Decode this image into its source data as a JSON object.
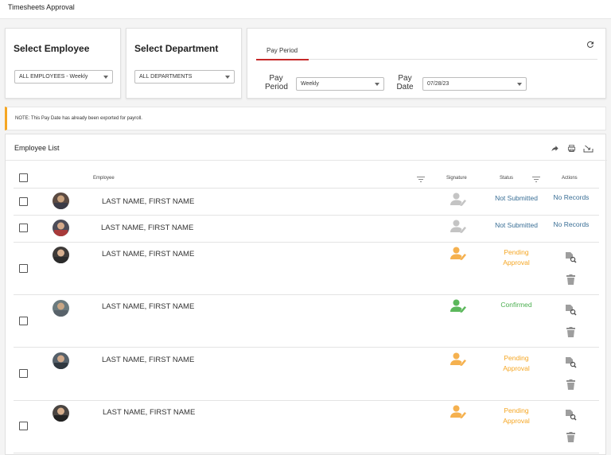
{
  "header": {
    "title": "Timesheets Approval"
  },
  "employee_filter": {
    "heading": "Select Employee",
    "selected": "ALL EMPLOYEES - Weekly"
  },
  "department_filter": {
    "heading": "Select Department",
    "selected": "ALL DEPARTMENTS"
  },
  "pay_period": {
    "tab_label": "Pay Period",
    "period_label_1": "Pay",
    "period_label_2": "Period",
    "period_value": "Weekly",
    "date_label_1": "Pay",
    "date_label_2": "Date",
    "date_value": "07/28/23"
  },
  "note": "NOTE: This Pay Date has already been exported for payroll.",
  "employee_list": {
    "title": "Employee List",
    "columns": {
      "employee": "Employee",
      "signature": "Signature",
      "status": "Status",
      "actions": "Actions"
    },
    "rows": [
      {
        "name": "LAST NAME, FIRST NAME",
        "status": "Not Submitted",
        "action": "No Records",
        "signature_color": "#c4c4c4"
      },
      {
        "name": "LAST NAME, FIRST NAME",
        "status": "Not Submitted",
        "action": "No Records",
        "signature_color": "#c4c4c4"
      },
      {
        "name": "LAST NAME, FIRST NAME",
        "status_1": "Pending",
        "status_2": "Approval",
        "signature_color": "#f5b14f"
      },
      {
        "name": "LAST NAME, FIRST NAME",
        "status": "Confirmed",
        "signature_color": "#5cb85c"
      },
      {
        "name": "LAST NAME, FIRST NAME",
        "status_1": "Pending",
        "status_2": "Approval",
        "signature_color": "#f5b14f"
      },
      {
        "name": "LAST NAME, FIRST NAME",
        "status_1": "Pending",
        "status_2": "Approval",
        "signature_color": "#f5b14f"
      }
    ]
  },
  "icons": {
    "refresh": "refresh-icon",
    "export": "share-icon",
    "print": "print-icon",
    "download": "download-icon",
    "signature": "person-sign-icon",
    "view": "document-search-icon",
    "delete": "trash-icon"
  }
}
